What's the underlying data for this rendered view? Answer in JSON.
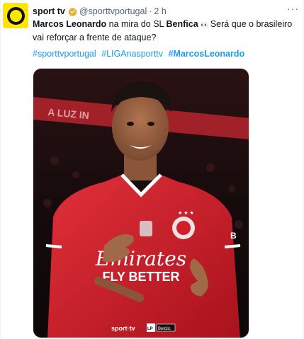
{
  "account": {
    "display_name": "sport tv",
    "handle": "@sporttvportugal",
    "separator": "·",
    "time": "2 h",
    "avatar_icon": "sporttv-logo-icon",
    "verified_icon": "gold-verified-badge-icon",
    "colors": {
      "avatar_bg": "#ffe600",
      "badge": "#e3b341"
    }
  },
  "tweet": {
    "name_bold": "Marcos Leonardo",
    "mid_text": " na mira do SL ",
    "club_bold": "Benfica",
    "emoji": "👀",
    "question": "  Será que o brasileiro vai reforçar a frente de ataque?",
    "hashtags": [
      "#sporttvportugal",
      "#LIGAnasporttv",
      "#MarcosLeonardo"
    ]
  },
  "menu": {
    "more_icon": "more-options-icon",
    "label": "···"
  },
  "media": {
    "description_icon": "player-photo",
    "shirt_sponsor_line1": "Emirates",
    "shirt_sponsor_line2": "FLY BETTER",
    "shirt_letter": "B",
    "banner_text": "A LUZ IN",
    "footer_logo": "sport·tv",
    "footer_partner_1": "LP",
    "footer_partner_2": "Betclic",
    "colors": {
      "shirt": "#d01f2a",
      "background": "#1a0f10",
      "light_band": "#c2262e"
    }
  }
}
